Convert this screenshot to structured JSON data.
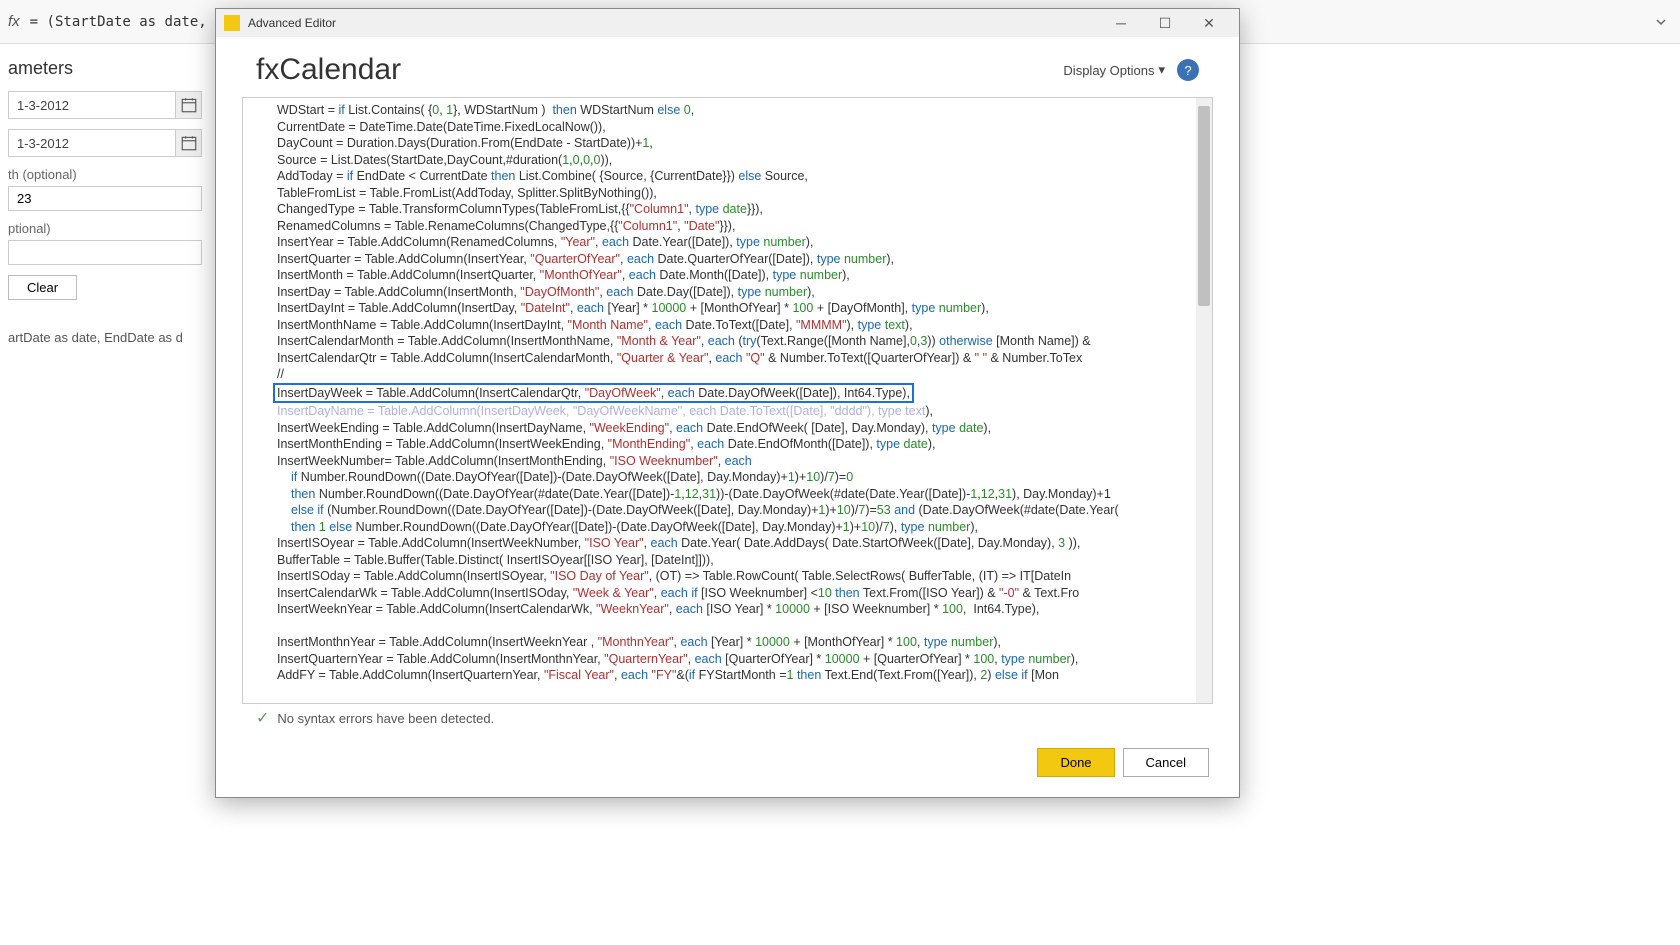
{
  "formula_bar": {
    "fx": "fx",
    "text": "= (StartDate as date, En"
  },
  "left_panel": {
    "title": "ameters",
    "date1": "1-3-2012",
    "date2": "1-3-2012",
    "field1_label": "th (optional)",
    "field1_value": "23",
    "field2_label": "ptional)",
    "clear": "Clear",
    "bottom": "artDate as date, EndDate as d"
  },
  "dialog": {
    "window_title": "Advanced Editor",
    "title": "fxCalendar",
    "display_options": "Display Options",
    "help": "?",
    "status": "No syntax errors have been detected.",
    "done": "Done",
    "cancel": "Cancel"
  },
  "chart_data": {
    "type": "code",
    "language": "M / Power Query",
    "highlighted_line_index": 17,
    "lines": [
      [
        [
          "WDStart = ",
          ""
        ],
        [
          "if",
          "blue"
        ],
        [
          " List.Contains( {",
          ""
        ],
        [
          "0",
          "num"
        ],
        [
          ", ",
          ""
        ],
        [
          "1",
          "num"
        ],
        [
          "}, WDStartNum )  ",
          ""
        ],
        [
          "then",
          "blue"
        ],
        [
          " WDStartNum ",
          ""
        ],
        [
          "else",
          "blue"
        ],
        [
          " ",
          ""
        ],
        [
          "0",
          "num"
        ],
        [
          ",",
          ""
        ]
      ],
      [
        [
          "CurrentDate = DateTime.Date(DateTime.FixedLocalNow()),",
          ""
        ]
      ],
      [
        [
          "DayCount = Duration.Days(Duration.From(EndDate - StartDate))+",
          ""
        ],
        [
          "1",
          "num"
        ],
        [
          ",",
          ""
        ]
      ],
      [
        [
          "Source = List.Dates(StartDate,DayCount,#duration(",
          ""
        ],
        [
          "1",
          "num"
        ],
        [
          ",",
          ""
        ],
        [
          "0",
          "num"
        ],
        [
          ",",
          ""
        ],
        [
          "0",
          "num"
        ],
        [
          ",",
          ""
        ],
        [
          "0",
          "num"
        ],
        [
          ")),",
          ""
        ]
      ],
      [
        [
          "AddToday = ",
          ""
        ],
        [
          "if",
          "blue"
        ],
        [
          " EndDate < CurrentDate ",
          ""
        ],
        [
          "then",
          "blue"
        ],
        [
          " List.Combine( {Source, {CurrentDate}}) ",
          ""
        ],
        [
          "else",
          "blue"
        ],
        [
          " Source,",
          ""
        ]
      ],
      [
        [
          "TableFromList = Table.FromList(AddToday, Splitter.SplitByNothing()),",
          ""
        ]
      ],
      [
        [
          "ChangedType = Table.TransformColumnTypes(TableFromList,{{",
          ""
        ],
        [
          "\"Column1\"",
          "red"
        ],
        [
          ", ",
          ""
        ],
        [
          "type",
          "blue"
        ],
        [
          " ",
          ""
        ],
        [
          "date",
          "green"
        ],
        [
          "}}),",
          ""
        ]
      ],
      [
        [
          "RenamedColumns = Table.RenameColumns(ChangedType,{{",
          ""
        ],
        [
          "\"Column1\"",
          "red"
        ],
        [
          ", ",
          ""
        ],
        [
          "\"Date\"",
          "red"
        ],
        [
          "}}),",
          ""
        ]
      ],
      [
        [
          "InsertYear = Table.AddColumn(RenamedColumns, ",
          ""
        ],
        [
          "\"Year\"",
          "red"
        ],
        [
          ", ",
          ""
        ],
        [
          "each",
          "blue"
        ],
        [
          " Date.Year([Date]), ",
          ""
        ],
        [
          "type",
          "blue"
        ],
        [
          " ",
          ""
        ],
        [
          "number",
          "green"
        ],
        [
          "),",
          ""
        ]
      ],
      [
        [
          "InsertQuarter = Table.AddColumn(InsertYear, ",
          ""
        ],
        [
          "\"QuarterOfYear\"",
          "red"
        ],
        [
          ", ",
          ""
        ],
        [
          "each",
          "blue"
        ],
        [
          " Date.QuarterOfYear([Date]), ",
          ""
        ],
        [
          "type",
          "blue"
        ],
        [
          " ",
          ""
        ],
        [
          "number",
          "green"
        ],
        [
          "),",
          ""
        ]
      ],
      [
        [
          "InsertMonth = Table.AddColumn(InsertQuarter, ",
          ""
        ],
        [
          "\"MonthOfYear\"",
          "red"
        ],
        [
          ", ",
          ""
        ],
        [
          "each",
          "blue"
        ],
        [
          " Date.Month([Date]), ",
          ""
        ],
        [
          "type",
          "blue"
        ],
        [
          " ",
          ""
        ],
        [
          "number",
          "green"
        ],
        [
          "),",
          ""
        ]
      ],
      [
        [
          "InsertDay = Table.AddColumn(InsertMonth, ",
          ""
        ],
        [
          "\"DayOfMonth\"",
          "red"
        ],
        [
          ", ",
          ""
        ],
        [
          "each",
          "blue"
        ],
        [
          " Date.Day([Date]), ",
          ""
        ],
        [
          "type",
          "blue"
        ],
        [
          " ",
          ""
        ],
        [
          "number",
          "green"
        ],
        [
          "),",
          ""
        ]
      ],
      [
        [
          "InsertDayInt = Table.AddColumn(InsertDay, ",
          ""
        ],
        [
          "\"DateInt\"",
          "red"
        ],
        [
          ", ",
          ""
        ],
        [
          "each",
          "blue"
        ],
        [
          " [Year] * ",
          ""
        ],
        [
          "10000",
          "num"
        ],
        [
          " + [MonthOfYear] * ",
          ""
        ],
        [
          "100",
          "num"
        ],
        [
          " + [DayOfMonth], ",
          ""
        ],
        [
          "type",
          "blue"
        ],
        [
          " ",
          ""
        ],
        [
          "number",
          "green"
        ],
        [
          "),",
          ""
        ]
      ],
      [
        [
          "InsertMonthName = Table.AddColumn(InsertDayInt, ",
          ""
        ],
        [
          "\"Month Name\"",
          "red"
        ],
        [
          ", ",
          ""
        ],
        [
          "each",
          "blue"
        ],
        [
          " Date.ToText([Date], ",
          ""
        ],
        [
          "\"MMMM\"",
          "red"
        ],
        [
          "), ",
          ""
        ],
        [
          "type",
          "blue"
        ],
        [
          " ",
          ""
        ],
        [
          "text",
          "green"
        ],
        [
          "),",
          ""
        ]
      ],
      [
        [
          "InsertCalendarMonth = Table.AddColumn(InsertMonthName, ",
          ""
        ],
        [
          "\"Month & Year\"",
          "red"
        ],
        [
          ", ",
          ""
        ],
        [
          "each",
          "blue"
        ],
        [
          " (",
          ""
        ],
        [
          "try",
          "blue"
        ],
        [
          "(Text.Range([Month Name],",
          ""
        ],
        [
          "0",
          "num"
        ],
        [
          ",",
          ""
        ],
        [
          "3",
          "num"
        ],
        [
          ")) ",
          ""
        ],
        [
          "otherwise",
          "blue"
        ],
        [
          " [Month Name]) & ",
          ""
        ]
      ],
      [
        [
          "InsertCalendarQtr = Table.AddColumn(InsertCalendarMonth, ",
          ""
        ],
        [
          "\"Quarter & Year\"",
          "red"
        ],
        [
          ", ",
          ""
        ],
        [
          "each",
          "blue"
        ],
        [
          " ",
          ""
        ],
        [
          "\"Q\"",
          "red"
        ],
        [
          " & Number.ToText([QuarterOfYear]) & ",
          ""
        ],
        [
          "\" \"",
          "red"
        ],
        [
          " & Number.ToTex",
          ""
        ]
      ],
      [
        [
          "//",
          ""
        ]
      ],
      [
        [
          "InsertDayWeek = Table.AddColumn(InsertCalendarQtr, ",
          ""
        ],
        [
          "\"DayOfWeek\"",
          "red"
        ],
        [
          ", ",
          ""
        ],
        [
          "each",
          "blue"
        ],
        [
          " Date.DayOfWeek([Date])",
          ""
        ],
        [
          ", Int64.Type),",
          ""
        ]
      ],
      [
        [
          "InsertDayName = Table.AddColumn(InsertDayWeek, ",
          "ob"
        ],
        [
          "\"DayOfWeekName\"",
          "obr"
        ],
        [
          ", ",
          "ob"
        ],
        [
          "each",
          "obb"
        ],
        [
          " Date.ToText([Date], ",
          "ob"
        ],
        [
          "\"dddd\"",
          "obr"
        ],
        [
          "), ",
          "ob"
        ],
        [
          "type",
          "obb"
        ],
        [
          " ",
          "ob"
        ],
        [
          "text",
          "obg"
        ],
        [
          "),",
          ""
        ]
      ],
      [
        [
          "InsertWeekEnding = Table.AddColumn(InsertDayName, ",
          ""
        ],
        [
          "\"WeekEnding\"",
          "red"
        ],
        [
          ", ",
          ""
        ],
        [
          "each",
          "blue"
        ],
        [
          " Date.EndOfWeek( [Date], Day.Monday), ",
          ""
        ],
        [
          "type",
          "blue"
        ],
        [
          " ",
          ""
        ],
        [
          "date",
          "green"
        ],
        [
          "),",
          ""
        ]
      ],
      [
        [
          "InsertMonthEnding = Table.AddColumn(InsertWeekEnding, ",
          ""
        ],
        [
          "\"MonthEnding\"",
          "red"
        ],
        [
          ", ",
          ""
        ],
        [
          "each",
          "blue"
        ],
        [
          " Date.EndOfMonth([Date]), ",
          ""
        ],
        [
          "type",
          "blue"
        ],
        [
          " ",
          ""
        ],
        [
          "date",
          "green"
        ],
        [
          "),",
          ""
        ]
      ],
      [
        [
          "InsertWeekNumber= Table.AddColumn(InsertMonthEnding, ",
          ""
        ],
        [
          "\"ISO Weeknumber\"",
          "red"
        ],
        [
          ", ",
          ""
        ],
        [
          "each",
          "blue"
        ]
      ],
      [
        [
          "if",
          "blue"
        ],
        [
          " Number.RoundDown((Date.DayOfYear([Date])-(Date.DayOfWeek([Date], Day.Monday)+",
          ""
        ],
        [
          "1",
          "num"
        ],
        [
          ")+",
          ""
        ],
        [
          "10",
          "num"
        ],
        [
          ")/",
          ""
        ],
        [
          "7",
          "num"
        ],
        [
          ")=",
          ""
        ],
        [
          "0",
          "num"
        ]
      ],
      [
        [
          "then",
          "blue"
        ],
        [
          " Number.RoundDown((Date.DayOfYear(#date(Date.Year([Date])-",
          ""
        ],
        [
          "1",
          "num"
        ],
        [
          ",",
          ""
        ],
        [
          "12",
          "num"
        ],
        [
          ",",
          ""
        ],
        [
          "31",
          "num"
        ],
        [
          "))-(Date.DayOfWeek(#date(Date.Year([Date])-",
          ""
        ],
        [
          "1",
          "num"
        ],
        [
          ",",
          ""
        ],
        [
          "12",
          "num"
        ],
        [
          ",",
          ""
        ],
        [
          "31",
          "num"
        ],
        [
          "), Day.Monday)+",
          ""
        ],
        [
          "1",
          ""
        ]
      ],
      [
        [
          "else if",
          "blue"
        ],
        [
          " (Number.RoundDown((Date.DayOfYear([Date])-(Date.DayOfWeek([Date], Day.Monday)+",
          ""
        ],
        [
          "1",
          "num"
        ],
        [
          ")+",
          ""
        ],
        [
          "10",
          "num"
        ],
        [
          ")/",
          ""
        ],
        [
          "7",
          "num"
        ],
        [
          ")=",
          ""
        ],
        [
          "53",
          "num"
        ],
        [
          " ",
          ""
        ],
        [
          "and",
          "blue"
        ],
        [
          " (Date.DayOfWeek(#date(Date.Year(",
          ""
        ]
      ],
      [
        [
          "then",
          "blue"
        ],
        [
          " ",
          ""
        ],
        [
          "1",
          "num"
        ],
        [
          " ",
          ""
        ],
        [
          "else",
          "blue"
        ],
        [
          " Number.RoundDown((Date.DayOfYear([Date])-(Date.DayOfWeek([Date], Day.Monday)+",
          ""
        ],
        [
          "1",
          "num"
        ],
        [
          ")+",
          ""
        ],
        [
          "10",
          "num"
        ],
        [
          ")/",
          ""
        ],
        [
          "7",
          "num"
        ],
        [
          "), ",
          ""
        ],
        [
          "type",
          "blue"
        ],
        [
          " ",
          ""
        ],
        [
          "number",
          "green"
        ],
        [
          "),",
          ""
        ]
      ],
      [
        [
          "InsertISOyear = Table.AddColumn(InsertWeekNumber, ",
          ""
        ],
        [
          "\"ISO Year\"",
          "red"
        ],
        [
          ", ",
          ""
        ],
        [
          "each",
          "blue"
        ],
        [
          " Date.Year( Date.AddDays( Date.StartOfWeek([Date], Day.Monday), ",
          ""
        ],
        [
          "3",
          "num"
        ],
        [
          " )),",
          ""
        ]
      ],
      [
        [
          "BufferTable = Table.Buffer(Table.Distinct( InsertISOyear[[ISO Year], [DateInt]])),",
          ""
        ]
      ],
      [
        [
          "InsertISOday = Table.AddColumn(InsertISOyear, ",
          ""
        ],
        [
          "\"ISO Day of Year\"",
          "red"
        ],
        [
          ", (OT) => Table.RowCount( Table.SelectRows( BufferTable, (IT) => IT[DateIn",
          ""
        ]
      ],
      [
        [
          "InsertCalendarWk = Table.AddColumn(InsertISOday, ",
          ""
        ],
        [
          "\"Week & Year\"",
          "red"
        ],
        [
          ", ",
          ""
        ],
        [
          "each",
          "blue"
        ],
        [
          " ",
          ""
        ],
        [
          "if",
          "blue"
        ],
        [
          " [ISO Weeknumber] <",
          ""
        ],
        [
          "10",
          "num"
        ],
        [
          " ",
          ""
        ],
        [
          "then",
          "blue"
        ],
        [
          " Text.From([ISO Year]) & ",
          ""
        ],
        [
          "\"-0\"",
          "red"
        ],
        [
          " & Text.Fro",
          ""
        ]
      ],
      [
        [
          "InsertWeeknYear = Table.AddColumn(InsertCalendarWk, ",
          ""
        ],
        [
          "\"WeeknYear\"",
          "red"
        ],
        [
          ", ",
          ""
        ],
        [
          "each",
          "blue"
        ],
        [
          " [ISO Year] * ",
          ""
        ],
        [
          "10000",
          "num"
        ],
        [
          " + [ISO Weeknumber] * ",
          ""
        ],
        [
          "100",
          "num"
        ],
        [
          ",  Int64.Type),",
          ""
        ]
      ],
      [
        [
          "",
          ""
        ]
      ],
      [
        [
          "InsertMonthnYear = Table.AddColumn(InsertWeeknYear , ",
          ""
        ],
        [
          "\"MonthnYear\"",
          "red"
        ],
        [
          ", ",
          ""
        ],
        [
          "each",
          "blue"
        ],
        [
          " [Year] * ",
          ""
        ],
        [
          "10000",
          "num"
        ],
        [
          " + [MonthOfYear] * ",
          ""
        ],
        [
          "100",
          "num"
        ],
        [
          ", ",
          ""
        ],
        [
          "type",
          "blue"
        ],
        [
          " ",
          ""
        ],
        [
          "number",
          "green"
        ],
        [
          "),",
          ""
        ]
      ],
      [
        [
          "InsertQuarternYear = Table.AddColumn(InsertMonthnYear, ",
          ""
        ],
        [
          "\"QuarternYear\"",
          "red"
        ],
        [
          ", ",
          ""
        ],
        [
          "each",
          "blue"
        ],
        [
          " [QuarterOfYear] * ",
          ""
        ],
        [
          "10000",
          "num"
        ],
        [
          " + [QuarterOfYear] * ",
          ""
        ],
        [
          "100",
          "num"
        ],
        [
          ", ",
          ""
        ],
        [
          "type",
          "blue"
        ],
        [
          " ",
          ""
        ],
        [
          "number",
          "green"
        ],
        [
          "),",
          ""
        ]
      ],
      [
        [
          "AddFY = Table.AddColumn(InsertQuarternYear, ",
          ""
        ],
        [
          "\"Fiscal Year\"",
          "red"
        ],
        [
          ", ",
          ""
        ],
        [
          "each",
          "blue"
        ],
        [
          " ",
          ""
        ],
        [
          "\"FY\"",
          "red"
        ],
        [
          "&(",
          ""
        ],
        [
          "if",
          "blue"
        ],
        [
          " FYStartMonth =",
          ""
        ],
        [
          "1",
          "num"
        ],
        [
          " ",
          ""
        ],
        [
          "then",
          "blue"
        ],
        [
          " Text.End(Text.From([Year]), ",
          ""
        ],
        [
          "2",
          "num"
        ],
        [
          ") ",
          ""
        ],
        [
          "else",
          "blue"
        ],
        [
          " ",
          ""
        ],
        [
          "if",
          "blue"
        ],
        [
          " [Mon",
          ""
        ]
      ]
    ]
  }
}
